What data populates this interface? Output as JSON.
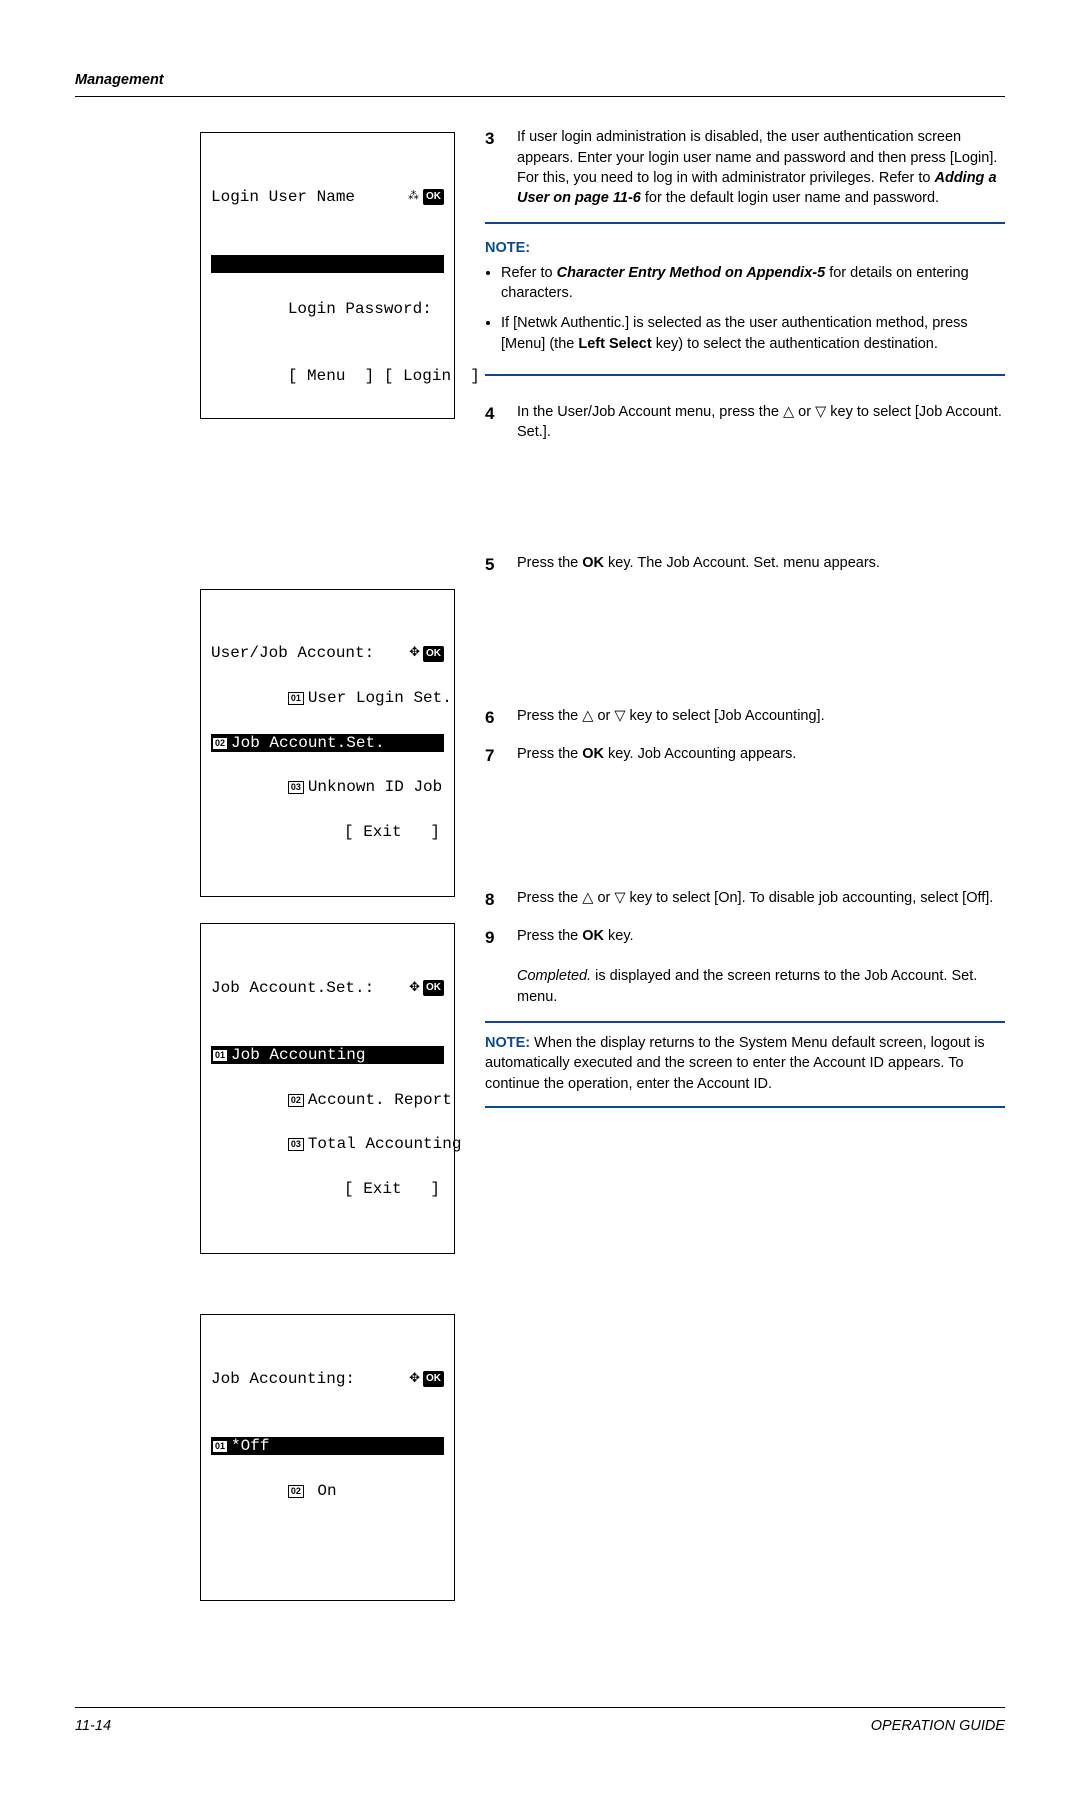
{
  "header": {
    "section": "Management"
  },
  "lcd1": {
    "title": "Login User Name",
    "password_label": "Login Password:",
    "soft_left": "[ Menu  ]",
    "soft_right": "[ Login  ]"
  },
  "lcd2": {
    "title": "User/Job Account:",
    "items": [
      {
        "num": "01",
        "label": "User Login Set."
      },
      {
        "num": "02",
        "label": "Job Account.Set."
      },
      {
        "num": "03",
        "label": "Unknown ID Job"
      }
    ],
    "exit": "[ Exit   ]"
  },
  "lcd3": {
    "title": "Job Account.Set.:",
    "items": [
      {
        "num": "01",
        "label": "Job Accounting"
      },
      {
        "num": "02",
        "label": "Account. Report"
      },
      {
        "num": "03",
        "label": "Total Accounting"
      }
    ],
    "exit": "[ Exit   ]"
  },
  "lcd4": {
    "title": "Job Accounting:",
    "items": [
      {
        "num": "01",
        "label": "*Off"
      },
      {
        "num": "02",
        "label": " On"
      }
    ]
  },
  "steps": {
    "s3": {
      "text_a": "If user login administration is disabled, the user authentication screen appears. Enter your login user name and password and then press [Login]. For this, you need to log in with administrator privileges. Refer to ",
      "link": "Adding a User on page 11-6",
      "text_b": " for the default login user name and password."
    },
    "note_a": {
      "title": "NOTE:",
      "b1_a": "Refer to ",
      "b1_link": "Character Entry Method on Appendix-5",
      "b1_b": " for details on entering characters.",
      "b2_a": "If [Netwk Authentic.] is selected as the user authentication method, press [Menu] (the ",
      "b2_bold": "Left Select",
      "b2_b": " key) to select the authentication destination."
    },
    "s4": "In the User/Job Account menu, press the △ or ▽ key to select [Job Account. Set.].",
    "s5_a": "Press the ",
    "s5_ok": "OK",
    "s5_b": " key. The Job Account. Set. menu appears.",
    "s6": "Press the △ or ▽ key to select [Job Accounting].",
    "s7_a": "Press the ",
    "s7_ok": "OK",
    "s7_b": " key. Job Accounting appears.",
    "s8": "Press the △ or ▽ key to select [On]. To disable job accounting, select [Off].",
    "s9_a": "Press the ",
    "s9_ok": "OK",
    "s9_b": " key.",
    "s9_comp": "Completed.",
    "s9_c": " is displayed and the screen returns to the Job Account. Set. menu.",
    "note_b": {
      "label": "NOTE:",
      "body": " When the display returns to the System Menu default screen, logout is automatically executed and the screen to enter the Account ID appears. To continue the operation, enter the Account ID."
    }
  },
  "footer": {
    "page": "11-14",
    "guide": "OPERATION GUIDE"
  }
}
